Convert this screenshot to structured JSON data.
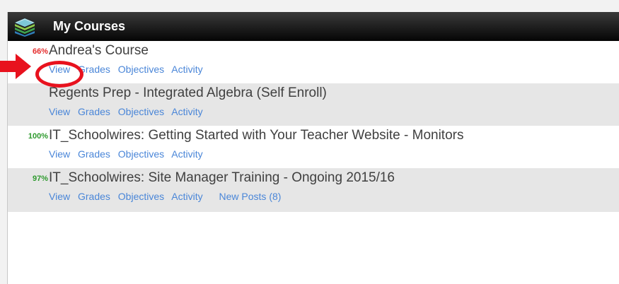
{
  "header": {
    "title": "My Courses",
    "icon": "books-stack-icon"
  },
  "courses": [
    {
      "percent": "66%",
      "percent_color": "#e52b2b",
      "title": "Andrea's Course",
      "links": [
        "View",
        "Grades",
        "Objectives",
        "Activity"
      ]
    },
    {
      "percent": "",
      "title": "Regents Prep - Integrated Algebra (Self Enroll)",
      "links": [
        "View",
        "Grades",
        "Objectives",
        "Activity"
      ]
    },
    {
      "percent": "100%",
      "percent_color": "#2e9a2e",
      "title": "IT_Schoolwires: Getting Started with Your Teacher Website - Monitors",
      "links": [
        "View",
        "Grades",
        "Objectives",
        "Activity"
      ]
    },
    {
      "percent": "97%",
      "percent_color": "#2e9a2e",
      "title": "IT_Schoolwires: Site Manager Training - Ongoing 2015/16",
      "links": [
        "View",
        "Grades",
        "Objectives",
        "Activity"
      ],
      "extra_link": "New Posts (8)"
    }
  ],
  "annotation": {
    "arrow_color": "#e8121e",
    "circle_color": "#e8121e"
  },
  "colors": {
    "link": "#4a86d8",
    "header_bg": "#000000",
    "alt_row": "#e6e6e6"
  }
}
